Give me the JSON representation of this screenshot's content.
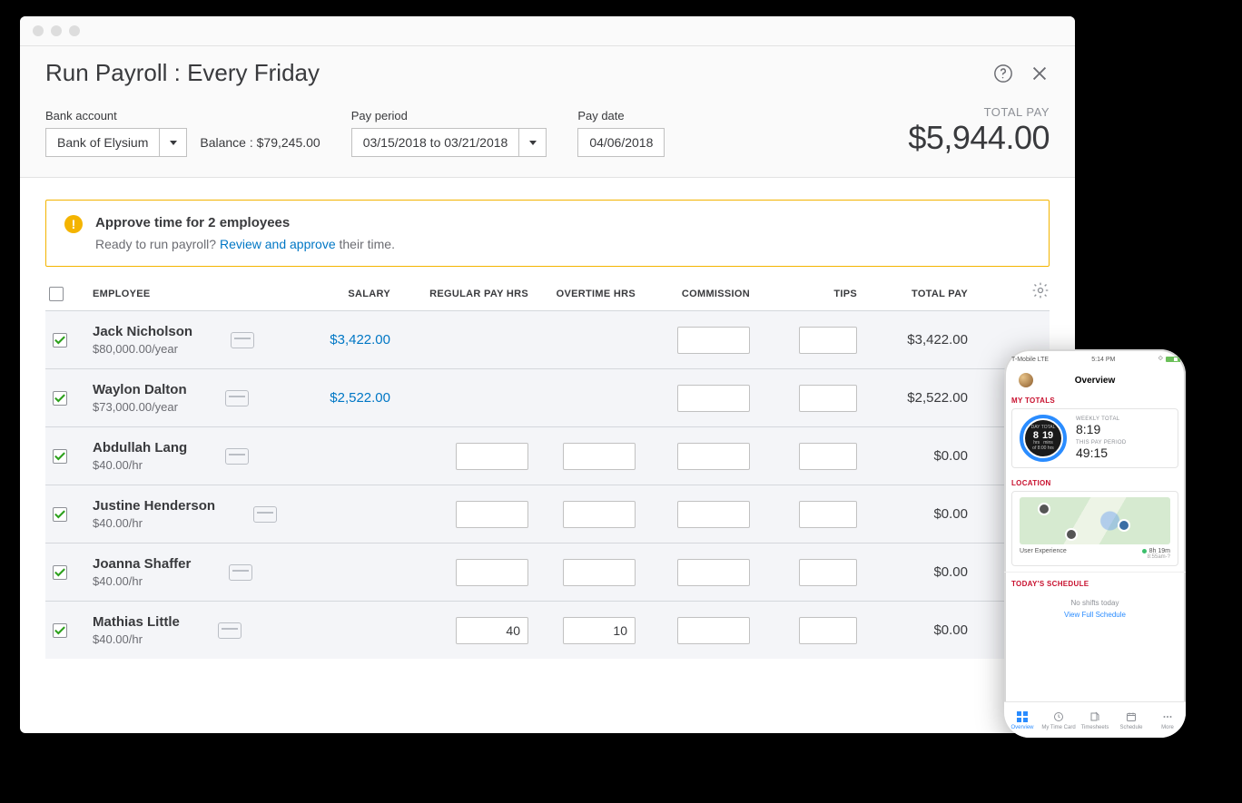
{
  "header": {
    "title": "Run Payroll : Every Friday",
    "bank_label": "Bank account",
    "bank_value": "Bank of Elysium",
    "balance_label": "Balance :",
    "balance_value": "$79,245.00",
    "period_label": "Pay period",
    "period_value": "03/15/2018 to 03/21/2018",
    "paydate_label": "Pay date",
    "paydate_value": "04/06/2018",
    "totalpay_label": "TOTAL PAY",
    "totalpay_value": "$5,944.00"
  },
  "alert": {
    "title": "Approve time for 2 employees",
    "lead": "Ready to run payroll? ",
    "link": "Review and approve",
    "tail": " their time."
  },
  "columns": {
    "employee": "EMPLOYEE",
    "salary": "SALARY",
    "regular": "REGULAR PAY HRS",
    "overtime": "OVERTIME HRS",
    "commission": "COMMISSION",
    "tips": "TIPS",
    "total": "TOTAL PAY"
  },
  "rows": [
    {
      "name": "Jack Nicholson",
      "rate": "$80,000.00/year",
      "salary": "$3,422.00",
      "reg": "",
      "ot": "",
      "reg_input": false,
      "ot_input": false,
      "total": "$3,422.00"
    },
    {
      "name": "Waylon Dalton",
      "rate": "$73,000.00/year",
      "salary": "$2,522.00",
      "reg": "",
      "ot": "",
      "reg_input": false,
      "ot_input": false,
      "total": "$2,522.00"
    },
    {
      "name": "Abdullah Lang",
      "rate": "$40.00/hr",
      "salary": "",
      "reg": "",
      "ot": "",
      "reg_input": true,
      "ot_input": true,
      "total": "$0.00"
    },
    {
      "name": "Justine Henderson",
      "rate": "$40.00/hr",
      "salary": "",
      "reg": "",
      "ot": "",
      "reg_input": true,
      "ot_input": true,
      "total": "$0.00"
    },
    {
      "name": "Joanna Shaffer",
      "rate": "$40.00/hr",
      "salary": "",
      "reg": "",
      "ot": "",
      "reg_input": true,
      "ot_input": true,
      "total": "$0.00"
    },
    {
      "name": "Mathias Little",
      "rate": "$40.00/hr",
      "salary": "",
      "reg": "40",
      "ot": "10",
      "reg_input": true,
      "ot_input": true,
      "total": "$0.00"
    }
  ],
  "phone": {
    "carrier": "T-Mobile  LTE",
    "time": "5:14 PM",
    "title": "Overview",
    "mytotals_label": "MY TOTALS",
    "day_label": "DAY TOTAL",
    "day_h": "8",
    "day_m": "19",
    "hrs": "hrs",
    "mins": "mins",
    "of_label": "of 8:00 hrs",
    "weekly_label": "WEEKLY TOTAL",
    "weekly_value": "8:19",
    "payperiod_label": "THIS PAY PERIOD",
    "payperiod_value": "49:15",
    "location_label": "LOCATION",
    "loc_name": "User Experience",
    "loc_duration": "8h 19m",
    "loc_time": "8:55am-?",
    "schedule_label": "TODAY'S SCHEDULE",
    "noshift": "No shifts today",
    "viewfull": "View Full Schedule",
    "tabs": [
      {
        "label": "Overview"
      },
      {
        "label": "My Time Card"
      },
      {
        "label": "Timesheets"
      },
      {
        "label": "Schedule"
      },
      {
        "label": "More"
      }
    ]
  }
}
